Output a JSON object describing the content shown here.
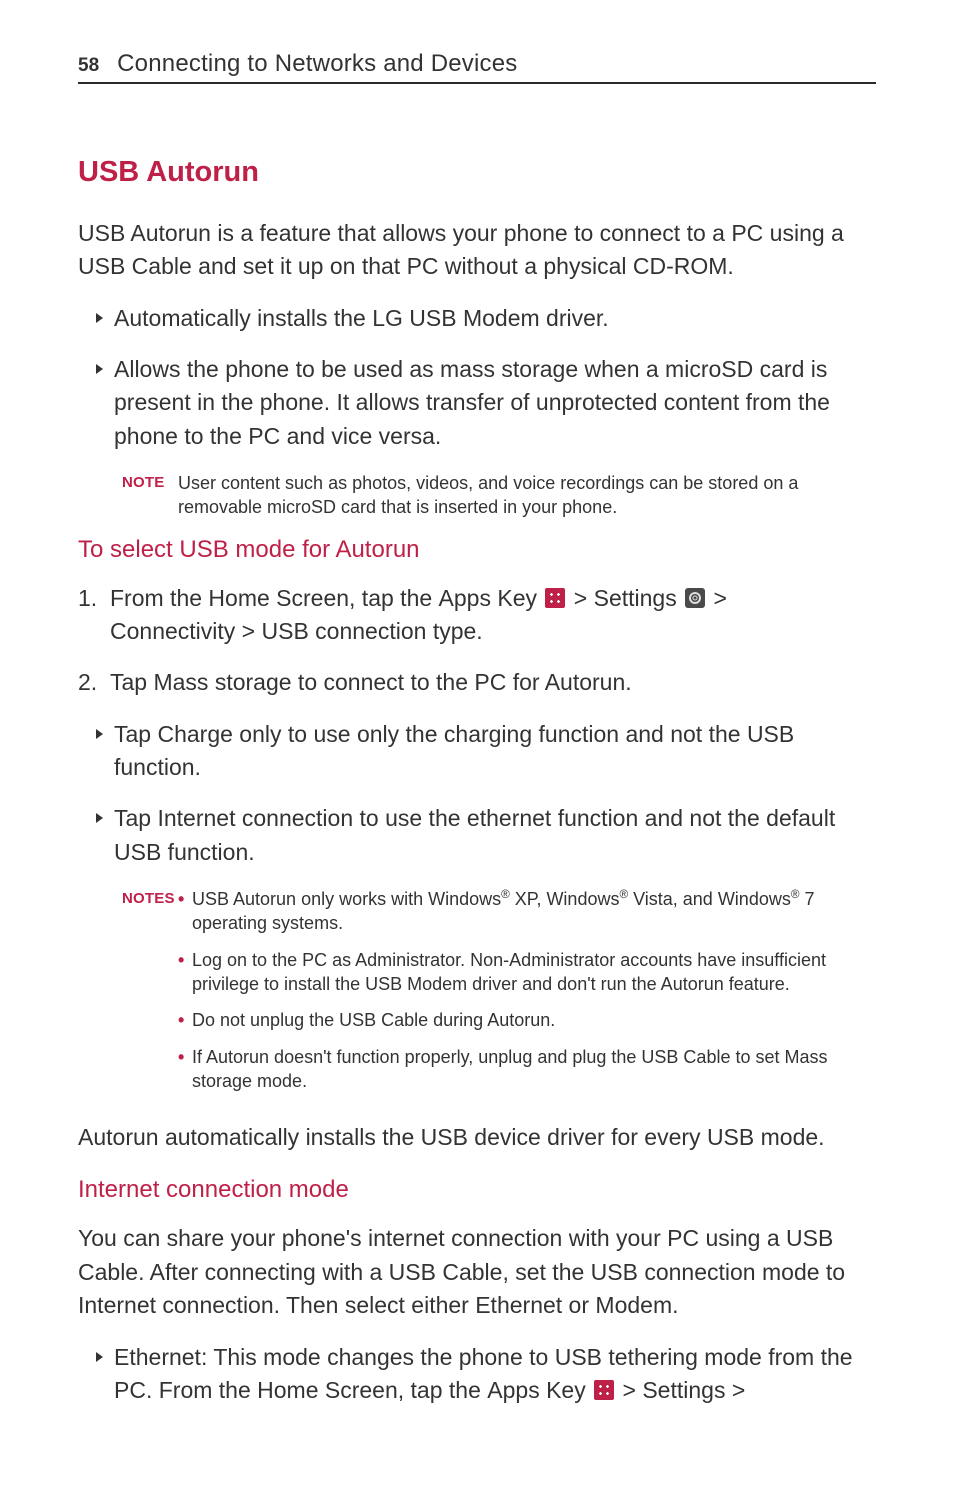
{
  "header": {
    "page_number": "58",
    "title": "Connecting to Networks and Devices"
  },
  "section_title": "USB Autorun",
  "intro": "USB Autorun is a feature that allows your phone to connect to a PC using a USB Cable and set it up on that PC without a physical CD-ROM.",
  "bullets": [
    "Automatically installs the LG USB Modem driver.",
    "Allows the phone to be used as mass storage when a microSD card is present in the phone. It allows transfer of unprotected content from the phone to the PC and vice versa."
  ],
  "note_label": "NOTE",
  "note_text": "User content such as photos, videos, and voice recordings can be stored on a removable microSD card that is inserted in your phone.",
  "sub1_title": "To select USB mode for Autorun",
  "step1_prefix": "From the Home Screen, tap the ",
  "apps_key": "Apps Key",
  "settings": "Settings",
  "step1_suffix_a": " > ",
  "step1_suffix_b": " > ",
  "step1_line2_a": "Connectivity",
  "step1_line2_b": " > ",
  "step1_line2_c": "USB connection type",
  "step2_prefix": "Tap ",
  "mass_storage": "Mass storage",
  "step2_suffix": " to connect to the PC for Autorun.",
  "sub_bullet_a_prefix": "Tap ",
  "charge_only": "Charge only",
  "sub_bullet_a_suffix": " to use only the charging function and not the USB function.",
  "sub_bullet_b_prefix": "Tap ",
  "internet_conn": "Internet connection",
  "sub_bullet_b_suffix": " to use the ethernet function and not the default USB function.",
  "notes_label": "NOTES",
  "notes_items": {
    "n1_a": "USB Autorun only works with Windows",
    "n1_b": " XP, Windows",
    "n1_c": " Vista, and Windows",
    "n1_d": " 7 operating systems.",
    "n2": "Log on to the PC as Administrator. Non-Administrator accounts have insufficient privilege to install the USB Modem driver and don't run the Autorun feature.",
    "n3": "Do not unplug the USB Cable during Autorun.",
    "n4": "If Autorun doesn't function properly, unplug and plug the USB Cable to set Mass storage mode."
  },
  "autorun_auto": "Autorun automatically installs the USB device driver for every USB mode.",
  "sub2_title": "Internet connection mode",
  "sub2_para_a": "You can share your phone's internet connection with your PC using a USB Cable. After connecting with a USB Cable, set the USB connection mode to Internet connection. Then select either ",
  "ethernet": "Ethernet",
  "or_word": " or ",
  "modem": "Modem",
  "period": ".",
  "eth_label": "Ethernet:",
  "eth_text_a": " This mode changes the phone to USB tethering mode from the PC. From the Home Screen, tap the ",
  "eth_text_b": " > ",
  "eth_text_c": " > "
}
